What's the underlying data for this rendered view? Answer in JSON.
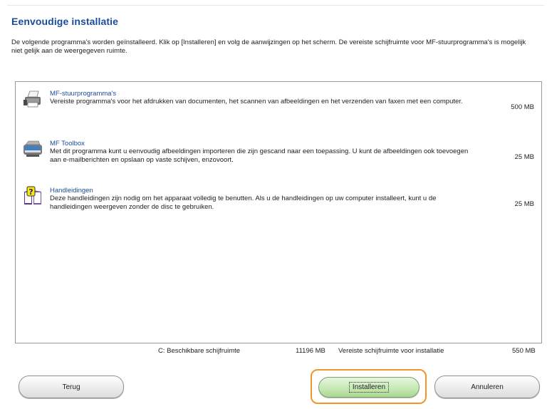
{
  "window": {
    "title": "Eenvoudige installatie",
    "intro": "De volgende programma's worden geïnstalleerd. Klik op [Installeren] en volg de aanwijzingen op het scherm. De vereiste schijfruimte voor MF-stuurprogramma's is mogelijk niet gelijk aan de weergegeven ruimte."
  },
  "items": [
    {
      "name": "MF-stuurprogramma's",
      "description": "Vereiste programma's voor het afdrukken van documenten, het scannen van afbeeldingen en het verzenden van faxen met een computer.",
      "size": "500 MB",
      "icon": "printer-icon"
    },
    {
      "name": "MF Toolbox",
      "description": "Met dit programma kunt u eenvoudig afbeeldingen importeren die zijn gescand naar een toepassing. U kunt de afbeeldingen ook toevoegen aan e-mailberichten en opslaan op vaste schijven, enzovoort.",
      "size": "25 MB",
      "icon": "scanner-icon"
    },
    {
      "name": "Handleidingen",
      "description": "Deze handleidingen zijn nodig om het apparaat volledig te benutten. Als u de handleidingen op uw computer installeert, kunt u de handleidingen weergeven zonder de disc te gebruiken.",
      "size": "25 MB",
      "icon": "manual-help-icon"
    }
  ],
  "status": {
    "drive_label": "C: Beschikbare schijfruimte",
    "drive_free": "11196 MB",
    "required_label": "Vereiste schijfruimte voor installatie",
    "required_value": "550 MB"
  },
  "buttons": {
    "back": "Terug",
    "install": "Installeren",
    "cancel": "Annuleren"
  },
  "colors": {
    "title": "#1b4c9c",
    "highlight": "#f0962c",
    "install_button": "#c7e9b6"
  }
}
